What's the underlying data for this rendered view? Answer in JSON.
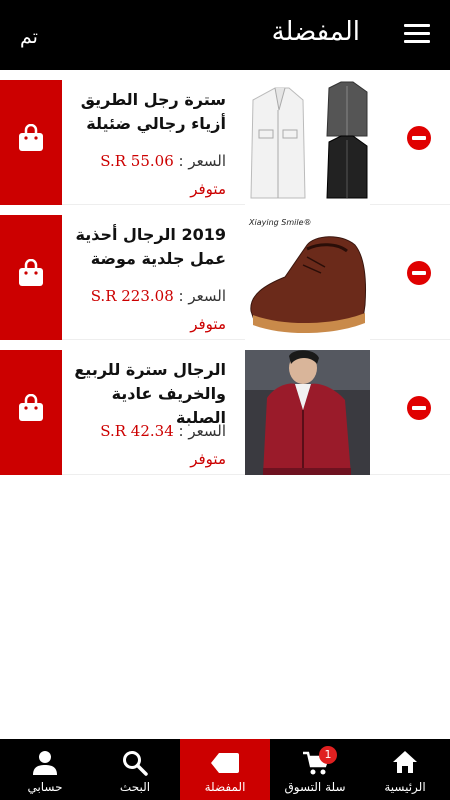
{
  "header": {
    "title": "المفضلة",
    "done_label": "تم"
  },
  "items": [
    {
      "name": "سترة رجل الطريق أزياء رجالي ضئيلة",
      "price_label": "السعر :",
      "price": "S.R 55.06",
      "availability": "متوفر",
      "image": "jackets-image"
    },
    {
      "name": "2019 الرجال أحذية عمل جلدية موضة",
      "price_label": "السعر :",
      "price": "S.R 223.08",
      "availability": "متوفر",
      "image": "shoe-image",
      "image_caption": "Xiaying Smile®"
    },
    {
      "name": "الرجال سترة للربيع والخريف عادية الصلبة",
      "price_label": "السعر :",
      "price": "S.R 42.34",
      "availability": "متوفر",
      "image": "red-jacket-image"
    }
  ],
  "bottom_nav": {
    "home": "الرئيسية",
    "cart": "سلة التسوق",
    "cart_badge": "1",
    "favorites": "المفضلة",
    "search": "البحث",
    "account": "حسابي"
  },
  "colors": {
    "accent": "#cc0000",
    "bar": "#000000"
  }
}
